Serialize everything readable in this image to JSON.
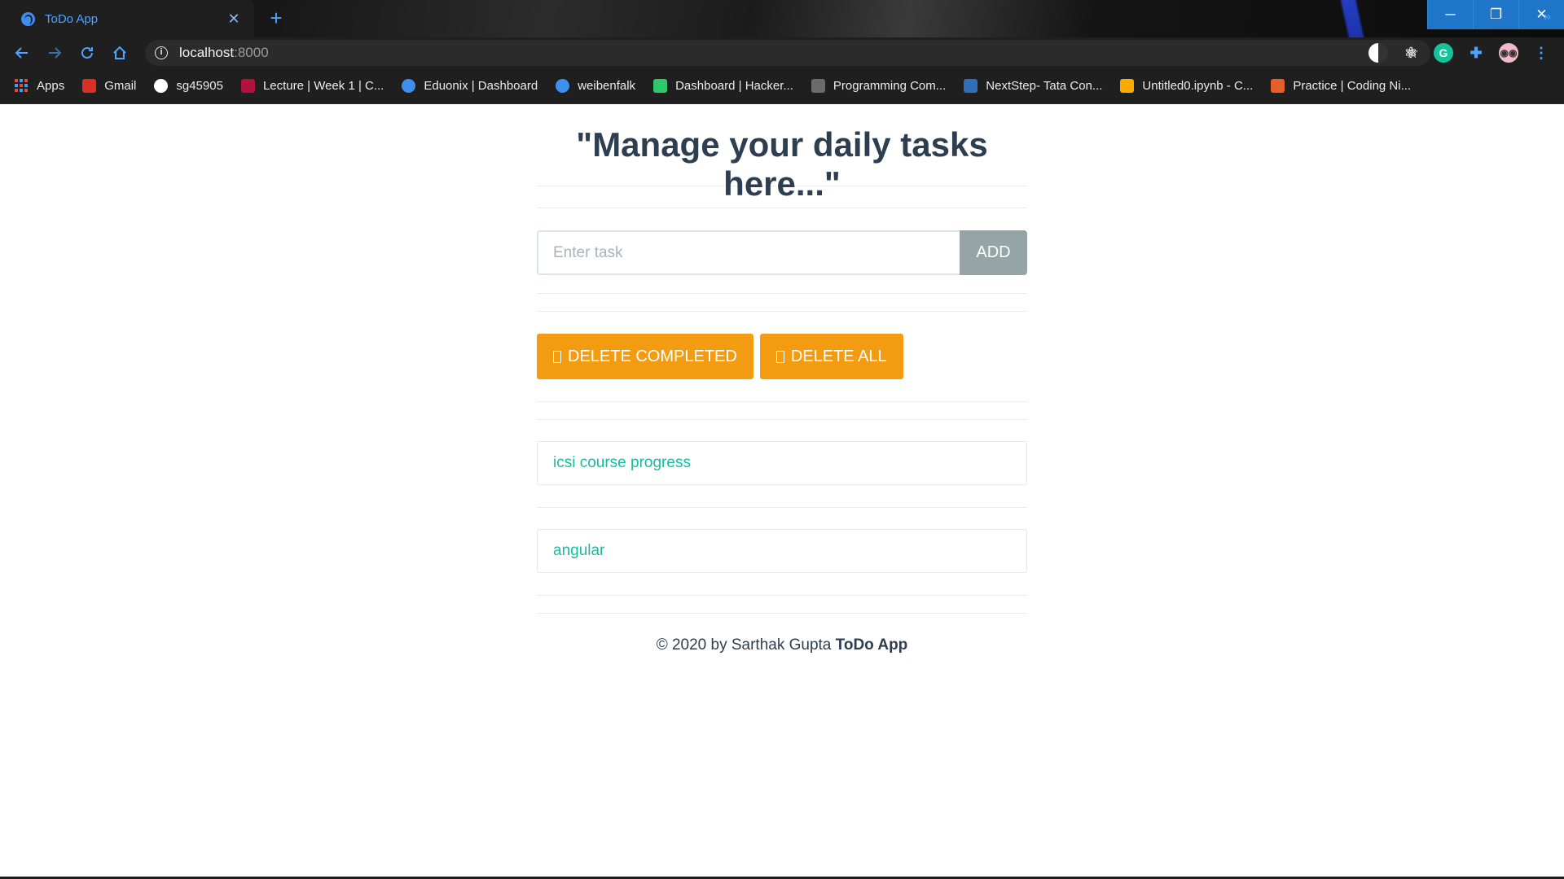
{
  "browser": {
    "tab_title": "ToDo App",
    "tab_close": "✕",
    "new_tab": "+",
    "url_host": "localhost",
    "url_port": ":8000",
    "window_buttons": {
      "minimize": "─",
      "restore": "❐",
      "close": "✕"
    },
    "bookmarks": [
      {
        "label": "Apps",
        "icon": "apps-grid-icon",
        "color": "#e8453c"
      },
      {
        "label": "Gmail",
        "icon": "gmail-icon",
        "color": "#d93025"
      },
      {
        "label": "sg45905",
        "icon": "github-icon",
        "color": "#ffffff"
      },
      {
        "label": "Lecture | Week 1 | C...",
        "icon": "edx-icon",
        "color": "#b3123c"
      },
      {
        "label": "Eduonix | Dashboard",
        "icon": "globe-icon",
        "color": "#3f8ff0"
      },
      {
        "label": "weibenfalk",
        "icon": "globe-icon",
        "color": "#3f8ff0"
      },
      {
        "label": "Dashboard | Hacker...",
        "icon": "hackerrank-icon",
        "color": "#2ec866"
      },
      {
        "label": "Programming Com...",
        "icon": "codechef-icon",
        "color": "#6b6b6b"
      },
      {
        "label": "NextStep- Tata Con...",
        "icon": "tata-icon",
        "color": "#2f6fb7"
      },
      {
        "label": "Untitled0.ipynb - C...",
        "icon": "colab-icon",
        "color": "#f9ab00"
      },
      {
        "label": "Practice | Coding Ni...",
        "icon": "codingninjas-icon",
        "color": "#e55f2a"
      }
    ]
  },
  "app": {
    "heading": "\"Manage your daily tasks here...\"",
    "input_placeholder": "Enter task",
    "add_label": "ADD",
    "delete_completed_label": "DELETE COMPLETED",
    "delete_all_label": "DELETE ALL",
    "tasks": [
      {
        "text": "icsi course progress"
      },
      {
        "text": "angular"
      }
    ],
    "footer_text": "© 2020 by Sarthak Gupta ",
    "footer_brand": "ToDo App"
  },
  "colors": {
    "accent": "#f39c12",
    "task_text": "#18bc9c",
    "add_button": "#95a5a6",
    "heading": "#2c3e50"
  }
}
